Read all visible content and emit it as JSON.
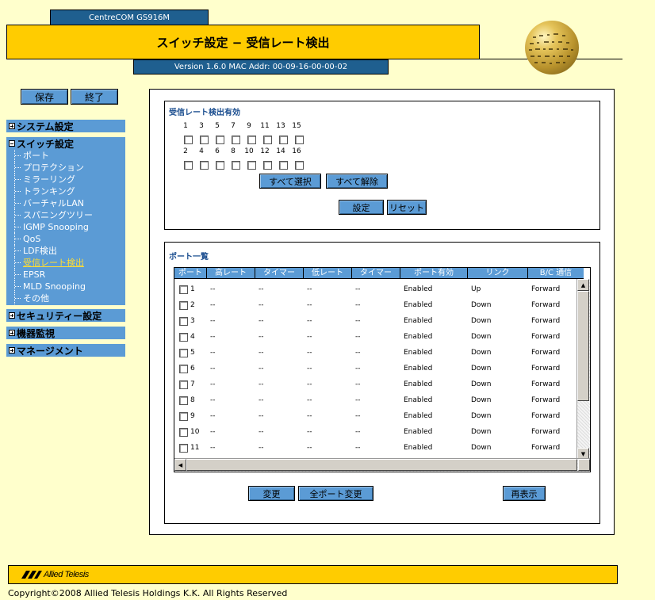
{
  "header": {
    "model": "CentreCOM GS916M",
    "title": "スイッチ設定 − 受信レート検出",
    "version": "Version 1.6.0 MAC Addr: 00-09-16-00-00-02"
  },
  "toolbar": {
    "save_label": "保存",
    "exit_label": "終了"
  },
  "sidebar": {
    "system": "システム設定",
    "switch": "スイッチ設定",
    "switch_items": [
      "ポート",
      "プロテクション",
      "ミラーリング",
      "トランキング",
      "バーチャルLAN",
      "スパニングツリー",
      "IGMP Snooping",
      "QoS",
      "LDF検出",
      "受信レート検出",
      "EPSR",
      "MLD Snooping",
      "その他"
    ],
    "security": "セキュリティー設定",
    "monitor": "機器監視",
    "management": "マネージメント"
  },
  "rate_detect": {
    "title": "受信レート検出有効",
    "odd_ports": [
      "1",
      "3",
      "5",
      "7",
      "9",
      "11",
      "13",
      "15"
    ],
    "even_ports": [
      "2",
      "4",
      "6",
      "8",
      "10",
      "12",
      "14",
      "16"
    ],
    "select_all": "すべて選択",
    "clear_all": "すべて解除",
    "apply": "設定",
    "reset": "リセット"
  },
  "port_list": {
    "title": "ポート一覧",
    "columns": [
      "ポート",
      "高レート",
      "タイマー",
      "低レート",
      "タイマー",
      "ポート有効",
      "リンク",
      "B/C 通信"
    ],
    "rows": [
      [
        "1",
        "--",
        "--",
        "--",
        "--",
        "Enabled",
        "Up",
        "Forward"
      ],
      [
        "2",
        "--",
        "--",
        "--",
        "--",
        "Enabled",
        "Down",
        "Forward"
      ],
      [
        "3",
        "--",
        "--",
        "--",
        "--",
        "Enabled",
        "Down",
        "Forward"
      ],
      [
        "4",
        "--",
        "--",
        "--",
        "--",
        "Enabled",
        "Down",
        "Forward"
      ],
      [
        "5",
        "--",
        "--",
        "--",
        "--",
        "Enabled",
        "Down",
        "Forward"
      ],
      [
        "6",
        "--",
        "--",
        "--",
        "--",
        "Enabled",
        "Down",
        "Forward"
      ],
      [
        "7",
        "--",
        "--",
        "--",
        "--",
        "Enabled",
        "Down",
        "Forward"
      ],
      [
        "8",
        "--",
        "--",
        "--",
        "--",
        "Enabled",
        "Down",
        "Forward"
      ],
      [
        "9",
        "--",
        "--",
        "--",
        "--",
        "Enabled",
        "Down",
        "Forward"
      ],
      [
        "10",
        "--",
        "--",
        "--",
        "--",
        "Enabled",
        "Down",
        "Forward"
      ],
      [
        "11",
        "--",
        "--",
        "--",
        "--",
        "Enabled",
        "Down",
        "Forward"
      ]
    ],
    "change": "変更",
    "change_all": "全ポート変更",
    "refresh": "再表示"
  },
  "footer": {
    "logo": "Allied Telesis",
    "copyright": "Copyright©2008 Allied Telesis Holdings K.K. All Rights Reserved"
  },
  "colors": {
    "header_blue": "#1f5f8f",
    "title_yellow": "#ffcc00",
    "nav_blue": "#5b9bd5",
    "page_bg": "#ffffcc"
  }
}
